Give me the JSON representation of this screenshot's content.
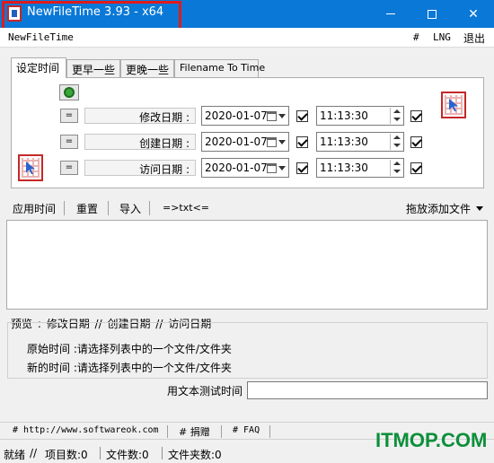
{
  "window": {
    "title": "NewFileTime 3.93 - x64"
  },
  "menubar": {
    "app_name": "NewFileTime",
    "hash": "#",
    "lng": "LNG",
    "exit": "退出"
  },
  "tabs": [
    {
      "label": "设定时间"
    },
    {
      "label": "更早一些"
    },
    {
      "label": "更晚一些"
    },
    {
      "label": "Filename To Time"
    }
  ],
  "rows": [
    {
      "eq": "=",
      "label": "修改日期 :",
      "date": "2020-01-07",
      "time": "11:13:30"
    },
    {
      "eq": "=",
      "label": "创建日期 :",
      "date": "2020-01-07",
      "time": "11:13:30"
    },
    {
      "eq": "=",
      "label": "访问日期 :",
      "date": "2020-01-07",
      "time": "11:13:30"
    }
  ],
  "toolbar": {
    "apply": "应用时间",
    "reset": "重置",
    "import": "导入",
    "txt": "=>txt<=",
    "drag_add": "拖放添加文件"
  },
  "preview": {
    "label": "预览 :",
    "modified": "修改日期",
    "sep": "//",
    "created": "创建日期",
    "accessed": "访问日期"
  },
  "info": {
    "original_label": "原始时间 :",
    "original_value": "请选择列表中的一个文件/文件夹",
    "new_label": "新的时间 :",
    "new_value": "请选择列表中的一个文件/文件夹"
  },
  "test": {
    "label": "用文本测试时间",
    "value": ""
  },
  "links": {
    "website": "# http://www.softwareok.com",
    "donate": "# 捐赠",
    "faq": "# FAQ"
  },
  "status": {
    "ready": "就绪",
    "sep": "//",
    "items": "项目数:0",
    "files": "文件数:0",
    "folders": "文件夹数:0"
  },
  "watermark": {
    "text": "ITMOP.COM"
  },
  "colors": {
    "titlebar": "#0a78d7",
    "highlight": "#e01b1b",
    "watermark": "#0b8f3a"
  }
}
